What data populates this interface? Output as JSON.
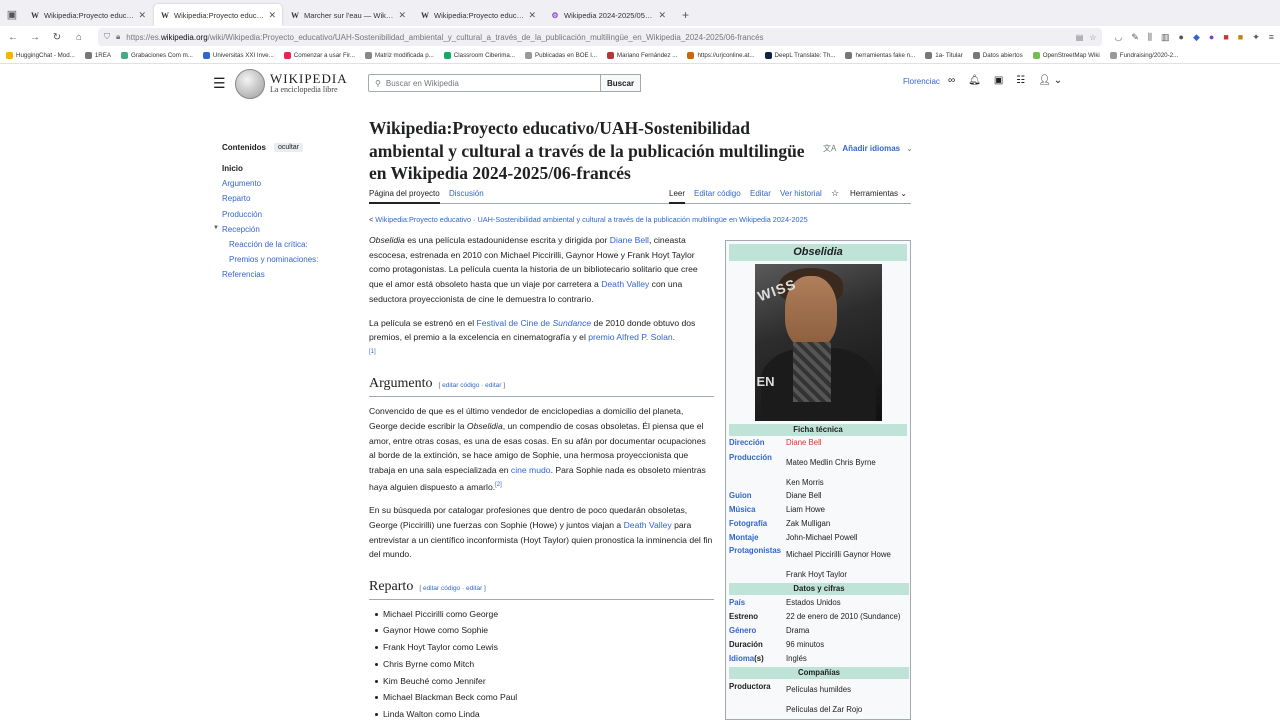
{
  "browser": {
    "tabs": [
      {
        "favicon": "W",
        "title": "Wikipedia:Proyecto educativo/U",
        "active": false
      },
      {
        "favicon": "W",
        "title": "Wikipedia:Proyecto educativo/U",
        "active": true
      },
      {
        "favicon": "W",
        "title": "Marcher sur l'eau — Wikipedia",
        "active": false
      },
      {
        "favicon": "W",
        "title": "Wikipedia:Proyecto educativo/U",
        "active": false
      },
      {
        "favicon": "⚙",
        "title": "Wikipedia 2024-2025/05-franc",
        "active": false
      }
    ],
    "url_prefix": "https://es.",
    "url_host": "wikipedia.org",
    "url_path": "/wiki/Wikipedia:Proyecto_educativo/UAH-Sostenibilidad_ambiental_y_cultural_a_través_de_la_publicación_multilingüe_en_Wikipedia_2024-2025/06-francés",
    "bookmarks": [
      {
        "label": "HuggingChat - Mod...",
        "color": "#f5b400"
      },
      {
        "label": "1REA",
        "color": "#777"
      },
      {
        "label": "Grabaciones Com m...",
        "color": "#4a8"
      },
      {
        "label": "Universitas XXI Inve...",
        "color": "#36c"
      },
      {
        "label": "Comenzar a usar Fir...",
        "color": "#e25"
      },
      {
        "label": "Matriz modificada p...",
        "color": "#888"
      },
      {
        "label": "Classroom Ciberima...",
        "color": "#1a6"
      },
      {
        "label": "Publicadas en BOE l...",
        "color": "#999"
      },
      {
        "label": "Mariano Fernández ...",
        "color": "#b33"
      },
      {
        "label": "https://urjconline.at...",
        "color": "#c60"
      },
      {
        "label": "DeepL Translate: Th...",
        "color": "#124"
      },
      {
        "label": "herramientas fake n...",
        "color": "#777"
      },
      {
        "label": "1a- Titular",
        "color": "#777"
      },
      {
        "label": "Datos abiertos",
        "color": "#777"
      },
      {
        "label": "OpenStreetMap Wiki",
        "color": "#7b5"
      },
      {
        "label": "Fundraising/2020-2...",
        "color": "#999"
      }
    ]
  },
  "wiki": {
    "logo_title": "WIKIPEDIA",
    "logo_tagline": "La enciclopedia libre",
    "search_placeholder": "Buscar en Wikipedia",
    "search_button": "Buscar",
    "username": "Florenciac",
    "title": "Wikipedia:Proyecto educativo/UAH-Sostenibilidad ambiental y cultural a través de la publicación multilingüe en Wikipedia 2024-2025/06-francés",
    "add_languages": "Añadir idiomas",
    "tab_project": "Página del proyecto",
    "tab_discussion": "Discusión",
    "tab_read": "Leer",
    "tab_edit_code": "Editar código",
    "tab_edit": "Editar",
    "tab_history": "Ver historial",
    "tab_tools": "Herramientas",
    "breadcrumb_prefix": "< ",
    "breadcrumb_link1": "Wikipedia:Proyecto educativo",
    "breadcrumb_sep": " · ",
    "breadcrumb_link2": "UAH-Sostenibilidad ambiental y cultural a través de la publicación multilingüe en Wikipedia 2024-2025"
  },
  "toc": {
    "heading": "Contenidos",
    "hide": "ocultar",
    "items": [
      {
        "label": "Inicio"
      },
      {
        "label": "Argumento"
      },
      {
        "label": "Reparto"
      },
      {
        "label": "Producción"
      },
      {
        "label": "Recepción"
      },
      {
        "label": "Reacción de la crítica:"
      },
      {
        "label": "Premios y nominaciones:"
      },
      {
        "label": "Referencias"
      }
    ]
  },
  "article": {
    "intro1_title": "Obselidia",
    "intro1_a": " es una película estadounidense escrita y dirigida por ",
    "intro1_director": "Diane Bell",
    "intro1_b": ", cineasta escocesa, estrenada en 2010 con Michael Piccirilli, Gaynor Howe y Frank Hoyt Taylor como protagonistas. La película cuenta la historia de un bibliotecario solitario que cree que el amor está obsoleto hasta que un viaje por carretera a ",
    "intro1_place": "Death Valley",
    "intro1_c": " con una seductora proyeccionista de cine le demuestra lo contrario.",
    "intro2_a": "La película se estrenó en el ",
    "intro2_festival": "Festival de Cine de ",
    "intro2_sundance": "Sundance",
    "intro2_b": " de 2010 donde obtuvo dos premios, el premio a la excelencia en cinematografía y el ",
    "intro2_prize": "premio Alfred P. Solan",
    "intro2_c": ".",
    "ref1": "[1]",
    "h_argumento": "Argumento",
    "edit_code": "editar código",
    "edit_sep": " · ",
    "edit": "editar",
    "arg1_a": "Convencido de que es el último vendedor de enciclopedias a domicilio del planeta, George decide escribir la ",
    "arg1_title": "Obselidia",
    "arg1_b": ", un compendio de cosas obsoletas. Él piensa que el amor, entre otras cosas, es una de esas cosas. En su afán por documentar ocupaciones al borde de la extinción, se hace amigo de Sophie, una hermosa proyeccionista que trabaja en una sala especializada en ",
    "arg1_silent": "cine mudo",
    "arg1_c": ". Para Sophie nada es obsoleto mientras haya alguien dispuesto a amarlo.",
    "ref2": "[2]",
    "arg2_a": "En su búsqueda por catalogar profesiones que dentro de poco quedarán obsoletas, George (Piccirilli) une fuerzas con Sophie (Howe) y juntos viajan a ",
    "arg2_place": "Death Valley",
    "arg2_b": " para entrevistar a un científico inconformista (Hoyt Taylor) quien pronostica la inminencia del fin del mundo.",
    "h_reparto": "Reparto",
    "cast": [
      "Michael Piccirilli como George",
      "Gaynor Howe como Sophie",
      "Frank Hoyt Taylor como Lewis",
      "Chris Byrne como Mitch",
      "Kim Beuché como Jennifer",
      "Michael Blackman Beck como Paul",
      "Linda Walton como Linda"
    ]
  },
  "infobox": {
    "title": "Obselidia",
    "photo_text1": "WISS",
    "photo_text2": "EN",
    "sec_ficha": "Ficha técnica",
    "direccion_k": "Dirección",
    "direccion_v": "Diane Bell",
    "produccion_k": "Producción",
    "produccion_v1": "Mateo Medlin Chris Byrne",
    "produccion_v2": "Ken Morris",
    "guion_k": "Guion",
    "guion_v": "Diane Bell",
    "musica_k": "Música",
    "musica_v": "Liam Howe",
    "fotografia_k": "Fotografía",
    "fotografia_v": "Zak Mulligan",
    "montaje_k": "Montaje",
    "montaje_v": "John-Michael Powell",
    "protagonistas_k": "Protagonistas",
    "protagonistas_v1": "Michael Piccirilli Gaynor Howe",
    "protagonistas_v2": "Frank Hoyt Taylor",
    "sec_datos": "Datos y cifras",
    "pais_k": "País",
    "pais_v": "Estados Unidos",
    "estreno_k": "Estreno",
    "estreno_v": "22 de enero de 2010 (Sundance)",
    "genero_k": "Género",
    "genero_v": "Drama",
    "duracion_k": "Duración",
    "duracion_v": "96 minutos",
    "idioma_k": "Idioma",
    "idioma_s": "(s)",
    "idioma_v": "Inglés",
    "sec_companias": "Compañías",
    "productora_k": "Productora",
    "productora_v1": "Películas humildes",
    "productora_v2": "Películas del Zar Rojo"
  }
}
